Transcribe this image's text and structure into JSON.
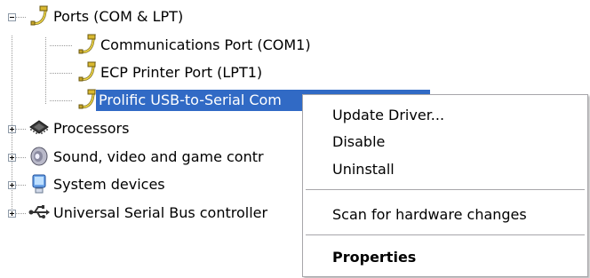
{
  "tree": {
    "ports": {
      "label": "Ports (COM & LPT)",
      "expanded": true,
      "icon": "port-connector-icon"
    },
    "port_children": [
      {
        "label": "Communications Port (COM1)",
        "icon": "port-connector-icon"
      },
      {
        "label": "ECP Printer Port (LPT1)",
        "icon": "port-connector-icon"
      },
      {
        "label": "Prolific USB-to-Serial Com",
        "icon": "port-connector-icon",
        "selected": true
      }
    ],
    "categories": [
      {
        "label": "Processors",
        "expanded": false,
        "icon": "processor-chip-icon"
      },
      {
        "label": "Sound, video and game contr",
        "expanded": false,
        "icon": "speaker-icon"
      },
      {
        "label": "System devices",
        "expanded": false,
        "icon": "computer-icon"
      },
      {
        "label": "Universal Serial Bus controller",
        "expanded": false,
        "icon": "usb-icon"
      }
    ]
  },
  "context_menu": {
    "items": [
      {
        "label": "Update Driver..."
      },
      {
        "label": "Disable"
      },
      {
        "label": "Uninstall"
      },
      {
        "label": "Scan for hardware changes"
      },
      {
        "label": "Properties",
        "default": true
      }
    ]
  },
  "colors": {
    "selection": "#316ac5",
    "menu_border": "#a7a6aa",
    "expander_border": "#8e9aa8"
  }
}
